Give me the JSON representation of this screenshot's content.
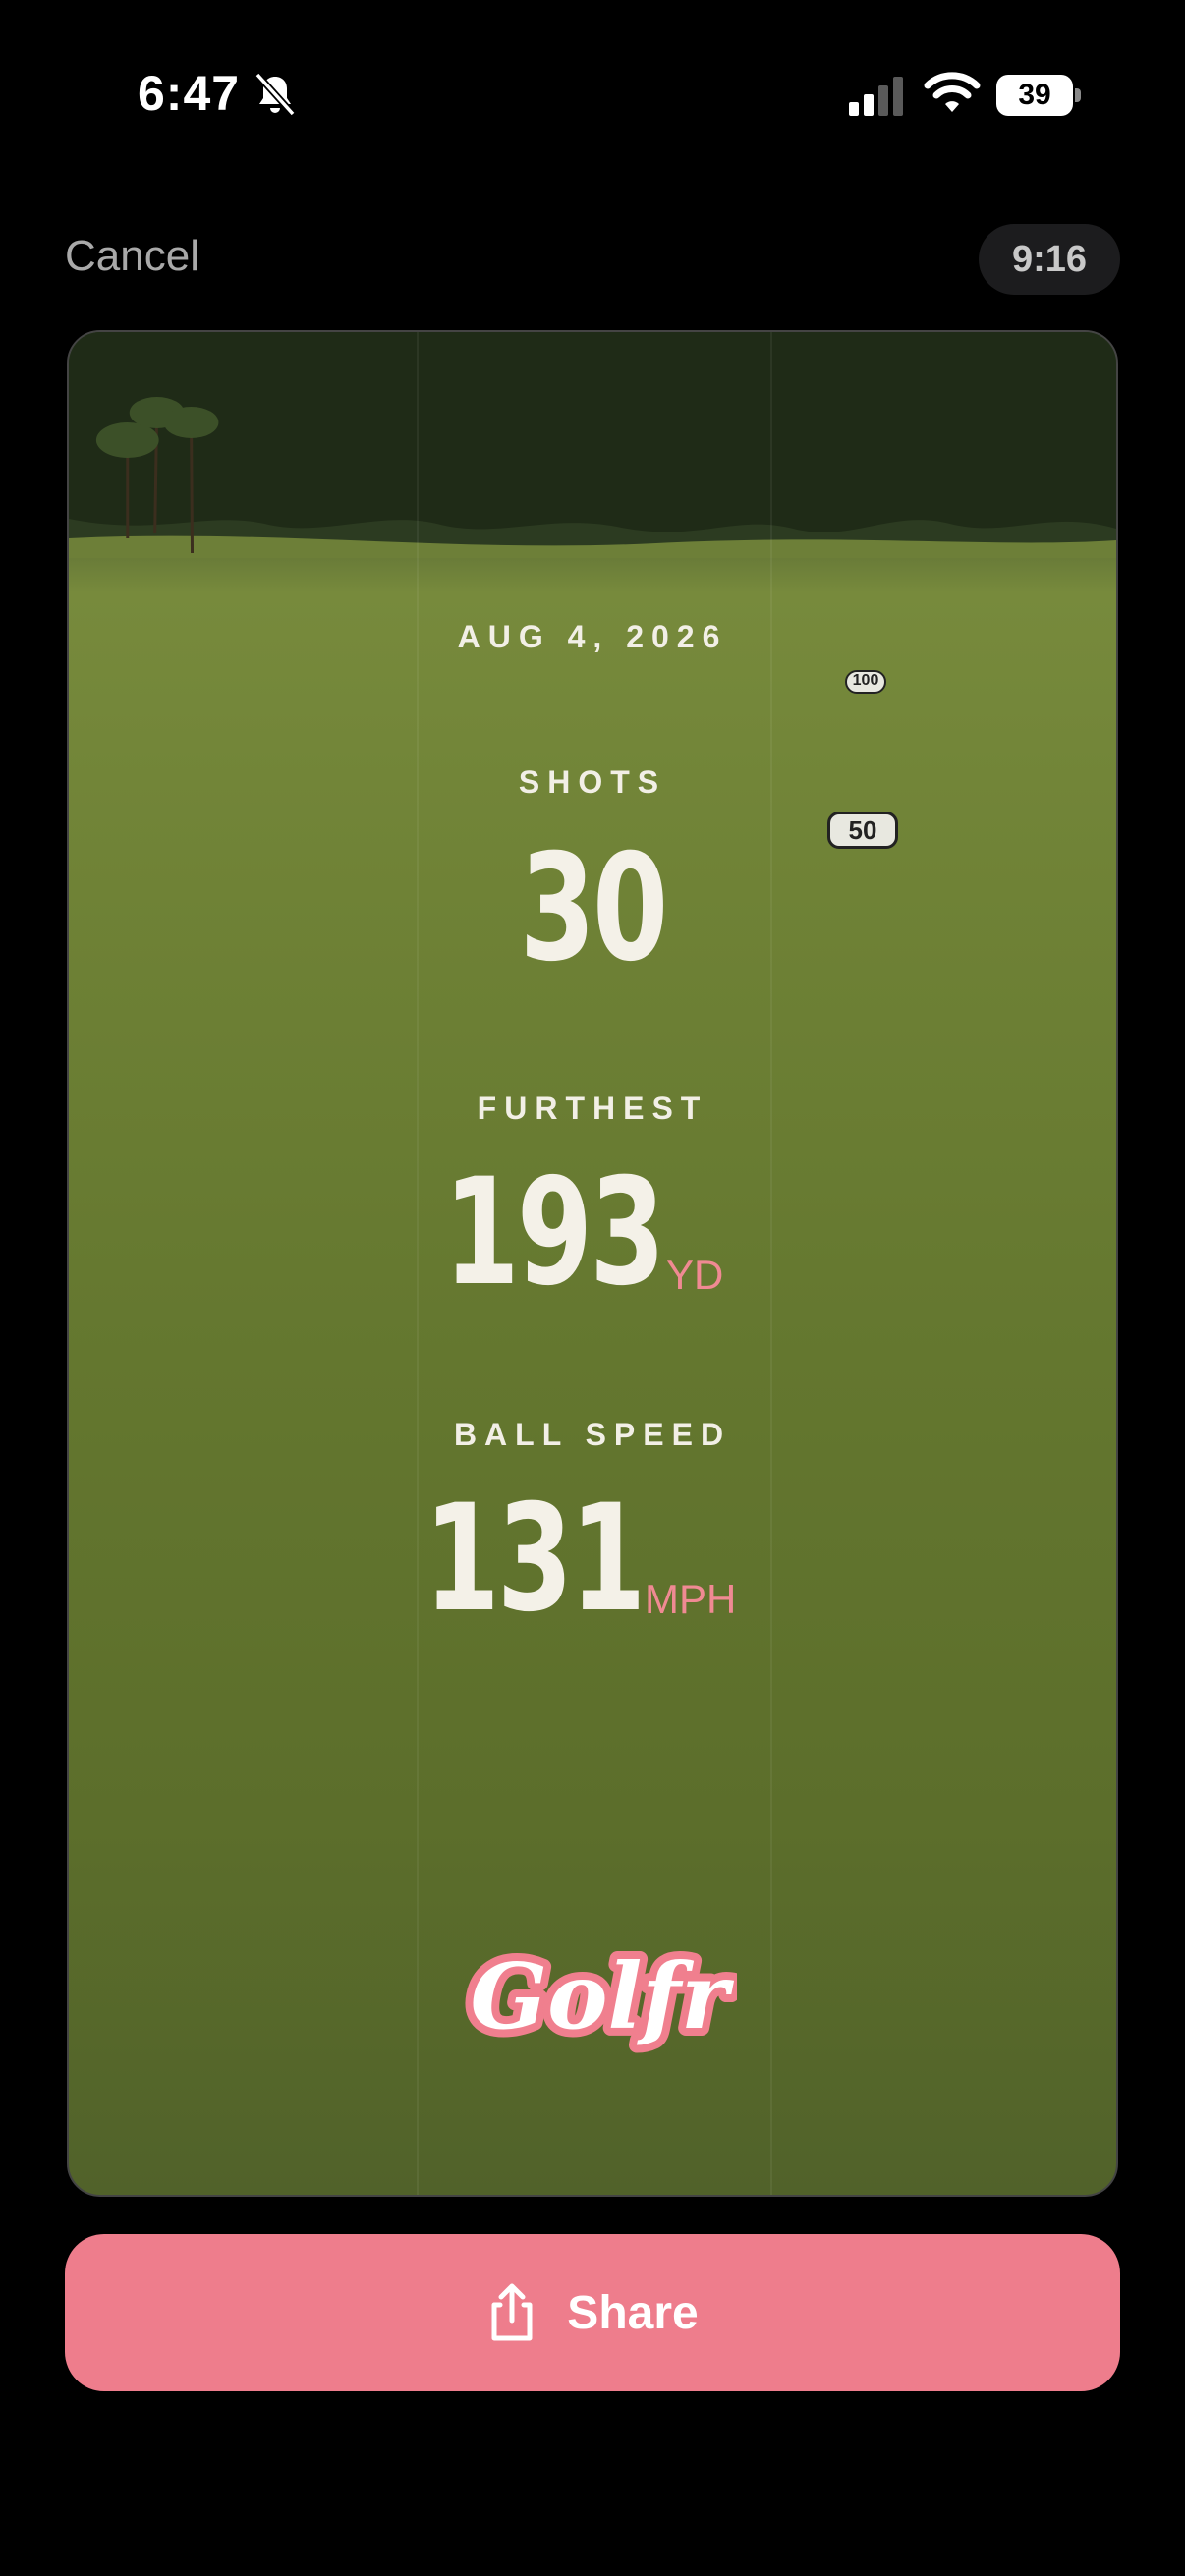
{
  "status_bar": {
    "time": "6:47",
    "battery_level": "39",
    "icons": [
      "bell-slash-icon",
      "cellular-signal-icon",
      "wifi-icon",
      "battery-icon"
    ]
  },
  "header": {
    "cancel_label": "Cancel",
    "aspect_ratio_label": "9:16"
  },
  "card": {
    "date": "AUG 4, 2026",
    "stats": [
      {
        "label": "SHOTS",
        "value": "30",
        "unit": ""
      },
      {
        "label": "FURTHEST",
        "value": "193",
        "unit": "YD"
      },
      {
        "label": "BALL SPEED",
        "value": "131",
        "unit": "MPH"
      }
    ],
    "markers": [
      "100",
      "50"
    ],
    "logo_text": "Golfr",
    "accent_color": "#ee7d8c"
  },
  "footer": {
    "share_label": "Share",
    "share_icon": "share-icon"
  }
}
